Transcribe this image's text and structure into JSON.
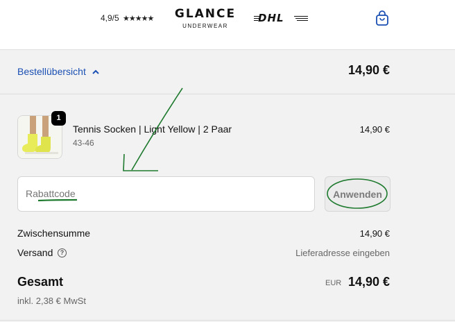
{
  "header": {
    "rating_text": "4,9/5",
    "stars": "★★★★★",
    "logo_main": "GLANCE",
    "logo_sub": "UNDERWEAR",
    "carrier_logo": "DHL"
  },
  "order_summary": {
    "toggle_label": "Bestellübersicht",
    "total_display": "14,90 €"
  },
  "cart_item": {
    "quantity": "1",
    "title": "Tennis Socken | Light Yellow | 2 Paar",
    "variant": "43-46",
    "price": "14,90 €"
  },
  "discount": {
    "placeholder": "Rabattcode",
    "apply_label": "Anwenden"
  },
  "totals": {
    "subtotal_label": "Zwischensumme",
    "subtotal_value": "14,90 €",
    "shipping_label": "Versand",
    "shipping_value": "Lieferadresse eingeben",
    "total_label": "Gesamt",
    "currency": "EUR",
    "total_value": "14,90 €",
    "tax_note": "inkl. 2,38 € MwSt"
  },
  "icons": {
    "stars": "star-icon",
    "bag": "shopping-bag-icon",
    "chevron": "chevron-up-icon",
    "help": "help-circle-icon"
  },
  "colors": {
    "link": "#1a4fb3",
    "annotation": "#1e7a2e",
    "product_yellow": "#e8ec58"
  }
}
